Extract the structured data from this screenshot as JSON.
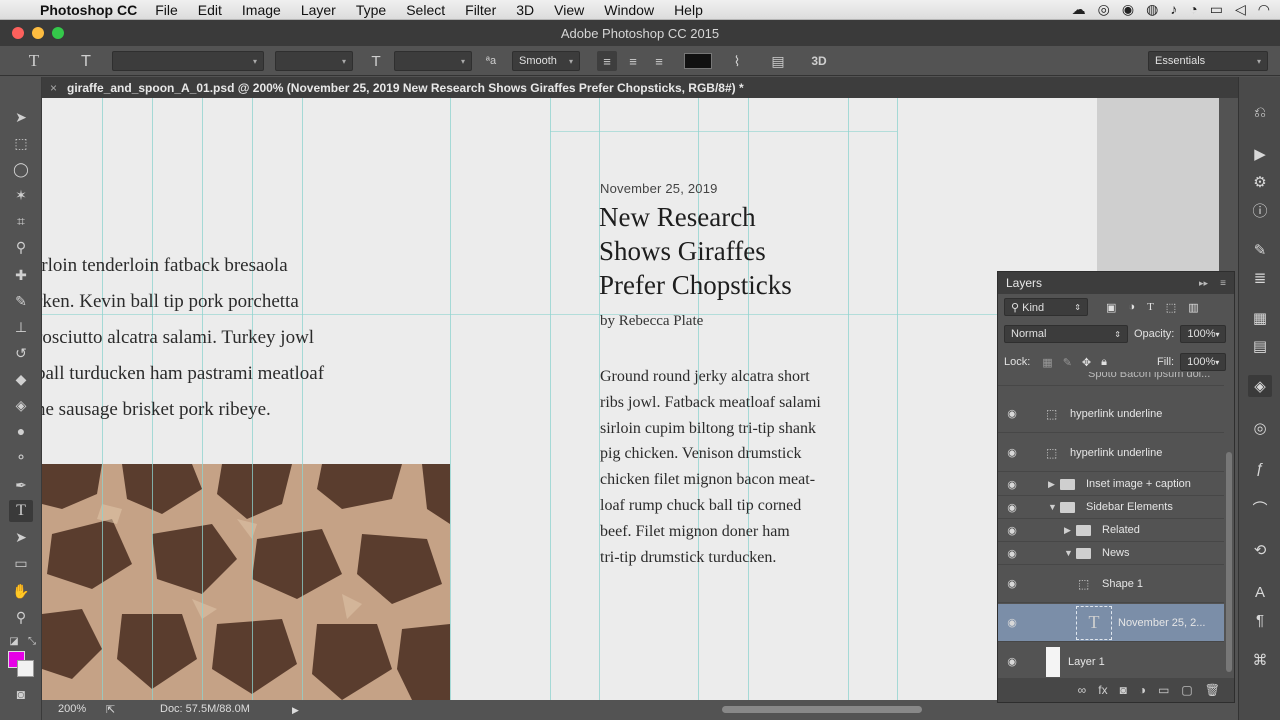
{
  "menubar": {
    "app_name": "Photoshop CC",
    "items": [
      "File",
      "Edit",
      "Image",
      "Layer",
      "Type",
      "Select",
      "Filter",
      "3D",
      "View",
      "Window",
      "Help"
    ]
  },
  "window": {
    "title": "Adobe Photoshop CC 2015"
  },
  "options": {
    "antialias": "Smooth",
    "workspace": "Essentials",
    "threed_label": "3D"
  },
  "document": {
    "tab_title": "giraffe_and_spoon_A_01.psd @ 200% (November 25, 2019 New Research Shows Giraffes Prefer Chopsticks, RGB/8#) *"
  },
  "canvas": {
    "left_lines": [
      "irloin tenderloin fatback bresaola",
      "rken. Kevin ball tip pork porchetta",
      "rosciutto alcatra salami. Turkey jowl",
      "ball turducken ham pastrami meatloaf",
      "ne sausage brisket pork ribeye."
    ],
    "article": {
      "date": "November 25, 2019",
      "headline_lines": [
        "New Research",
        "Shows Giraffes",
        "Prefer Chopsticks"
      ],
      "byline": "by Rebecca Plate",
      "body_lines": [
        "Ground round jerky alcatra short",
        "ribs jowl. Fatback meatloaf salami",
        "sirloin cupim biltong tri-tip shank",
        "pig chicken. Venison drumstick",
        "chicken filet mignon bacon meat-",
        "loaf rump chuck ball tip corned",
        "beef. Filet mignon doner ham",
        "tri-tip drumstick turducken."
      ]
    }
  },
  "status": {
    "zoom": "200%",
    "doc_size": "Doc: 57.5M/88.0M"
  },
  "layers_panel": {
    "title": "Layers",
    "filter_kind": "Kind",
    "blend_mode": "Normal",
    "opacity_label": "Opacity:",
    "opacity_value": "100%",
    "lock_label": "Lock:",
    "fill_label": "Fill:",
    "fill_value": "100%",
    "layers": [
      {
        "name": "Spoto Bacon ipsum dol..."
      },
      {
        "name": "hyperlink underline"
      },
      {
        "name": "hyperlink underline"
      },
      {
        "name": "Inset image + caption"
      },
      {
        "name": "Sidebar Elements"
      },
      {
        "name": "Related"
      },
      {
        "name": "News"
      },
      {
        "name": "Shape 1"
      },
      {
        "name": "November 25, 2..."
      },
      {
        "name": "Layer 1"
      }
    ]
  },
  "colors": {
    "foreground": "#e600e6",
    "background": "#f2f2f2",
    "selected_layer": "#7b8ea8"
  }
}
